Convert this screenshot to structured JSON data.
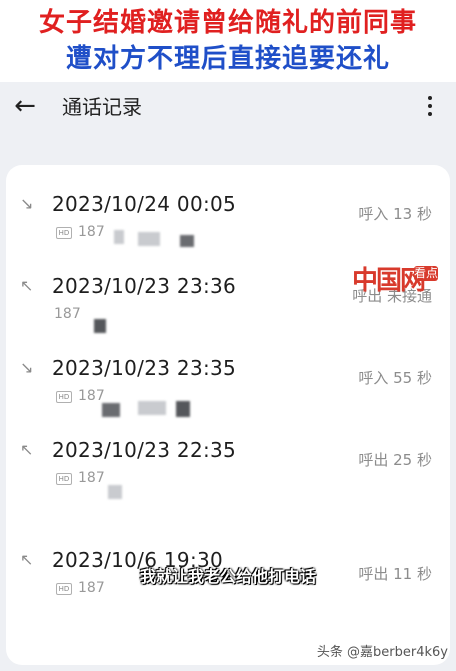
{
  "banner": {
    "line1": "女子结婚邀请曾给随礼的前同事",
    "line2": "遭对方不理后直接追要还礼"
  },
  "appbar": {
    "back_icon": "←",
    "title": "通话记录"
  },
  "records": [
    {
      "direction": "incoming",
      "arrow": "↘",
      "datetime": "2023/10/24 00:05",
      "number": "187",
      "status": "呼入 13 秒"
    },
    {
      "direction": "outgoing",
      "arrow": "↖",
      "datetime": "2023/10/23 23:36",
      "number": "187",
      "status": "呼出 未接通"
    },
    {
      "direction": "incoming",
      "arrow": "↘",
      "datetime": "2023/10/23 23:35",
      "number": "187",
      "status": "呼入 55 秒"
    },
    {
      "direction": "outgoing",
      "arrow": "↖",
      "datetime": "2023/10/23 22:35",
      "number": "187",
      "status": "呼出 25 秒"
    },
    {
      "direction": "outgoing",
      "arrow": "↖",
      "datetime": "2023/10/6 19:30",
      "number": "187",
      "status": "呼出 11 秒"
    }
  ],
  "watermark": {
    "main": "中国网",
    "side": "看点"
  },
  "subtitle": "我就让我老公给他打电话",
  "credit": "头条 @嘉berber4k6y"
}
